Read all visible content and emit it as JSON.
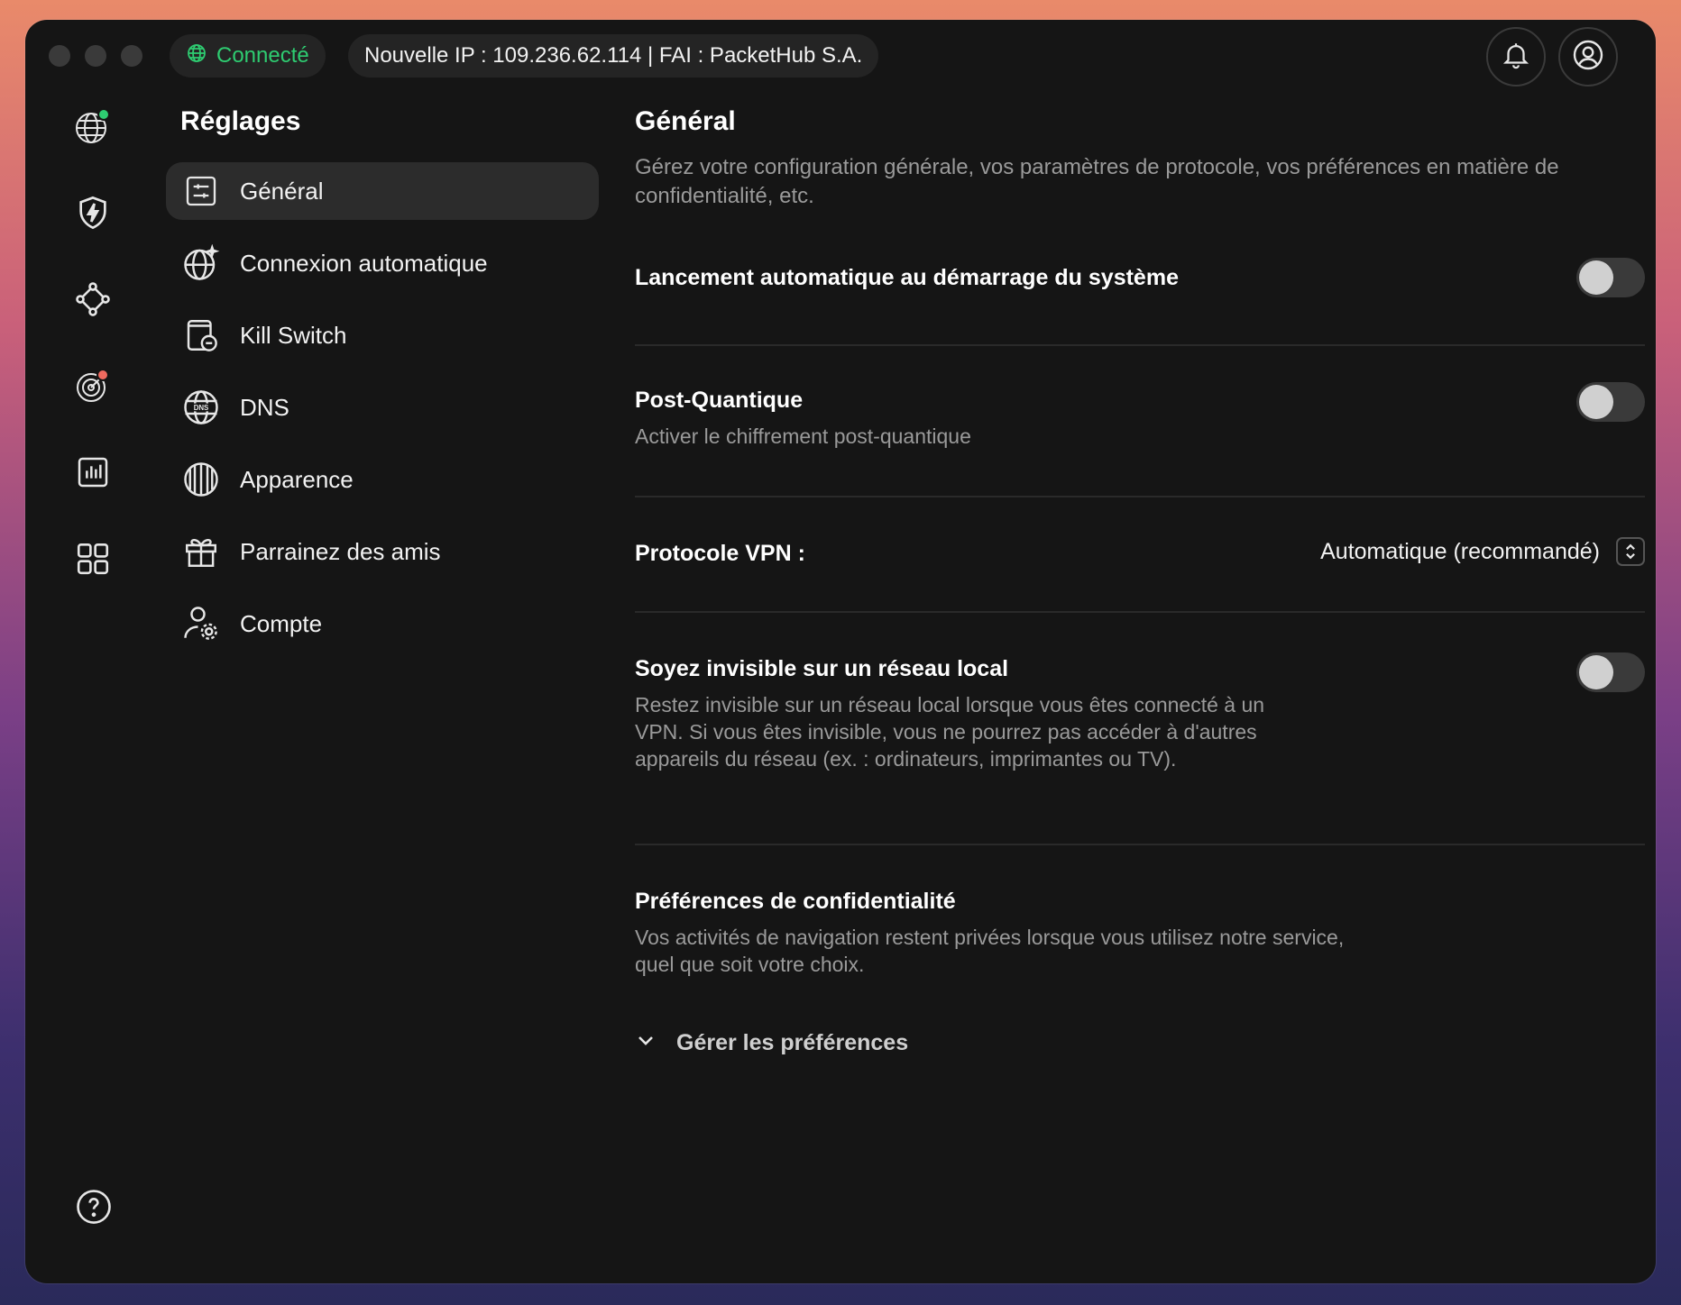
{
  "status": {
    "label": "Connecté",
    "icon": "globe-icon",
    "color": "#2ecc71"
  },
  "connection_info": "Nouvelle IP : 109.236.62.114 | FAI : PacketHub S.A.",
  "top_buttons": [
    {
      "icon": "bell-icon"
    },
    {
      "icon": "profile-icon"
    }
  ],
  "rail": [
    {
      "icon": "globe-connected-icon"
    },
    {
      "icon": "shield-bolt-icon"
    },
    {
      "icon": "mesh-network-icon"
    },
    {
      "icon": "radar-alert-icon"
    },
    {
      "icon": "statistics-icon"
    },
    {
      "icon": "apps-grid-icon"
    },
    {
      "icon": "help-icon"
    }
  ],
  "nav": {
    "title": "Réglages",
    "items": [
      {
        "label": "Général",
        "icon": "sliders-icon",
        "active": true
      },
      {
        "label": "Connexion automatique",
        "icon": "globe-sparkle-icon"
      },
      {
        "label": "Kill Switch",
        "icon": "kill-switch-icon"
      },
      {
        "label": "DNS",
        "icon": "dns-globe-icon"
      },
      {
        "label": "Apparence",
        "icon": "appearance-icon"
      },
      {
        "label": "Parrainez des amis",
        "icon": "gift-icon"
      },
      {
        "label": "Compte",
        "icon": "account-gear-icon"
      }
    ]
  },
  "general": {
    "title": "Général",
    "description": "Gérez votre configuration générale, vos paramètres de protocole, vos préférences en matière de confidentialité, etc.",
    "autolaunch": {
      "title": "Lancement automatique au démarrage du système",
      "enabled": false
    },
    "post_quantum": {
      "title": "Post-Quantique",
      "subtitle": "Activer le chiffrement post-quantique",
      "enabled": false
    },
    "protocol": {
      "title": "Protocole VPN :",
      "value": "Automatique (recommandé)"
    },
    "invisible": {
      "title": "Soyez invisible sur un réseau local",
      "subtitle": "Restez invisible sur un réseau local lorsque vous êtes connecté à un VPN. Si vous êtes invisible, vous ne pourrez pas accéder à d'autres appareils du réseau (ex. : ordinateurs, imprimantes ou TV).",
      "enabled": false
    },
    "privacy": {
      "title": "Préférences de confidentialité",
      "subtitle": "Vos activités de navigation restent privées lorsque vous utilisez notre service, quel que soit votre choix.",
      "manage_label": "Gérer les préférences"
    }
  }
}
